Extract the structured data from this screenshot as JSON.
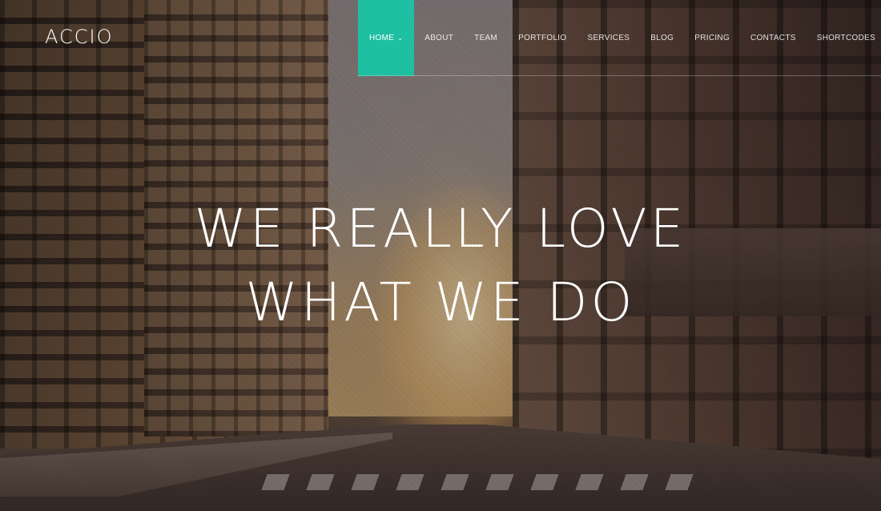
{
  "brand": {
    "logo": "ACCIO"
  },
  "nav": {
    "items": [
      {
        "label": "HOME",
        "active": true,
        "has_dropdown": true
      },
      {
        "label": "ABOUT"
      },
      {
        "label": "TEAM"
      },
      {
        "label": "PORTFOLIO"
      },
      {
        "label": "SERVICES"
      },
      {
        "label": "BLOG"
      },
      {
        "label": "PRICING"
      },
      {
        "label": "CONTACTS"
      },
      {
        "label": "SHORTCODES"
      }
    ],
    "dropdown_icon": "chevron-down-icon"
  },
  "hero": {
    "line1": "WE REALLY LOVE",
    "line2": "WHAT WE DO"
  },
  "colors": {
    "accent": "#1fbfa3",
    "text": "#ffffff"
  }
}
